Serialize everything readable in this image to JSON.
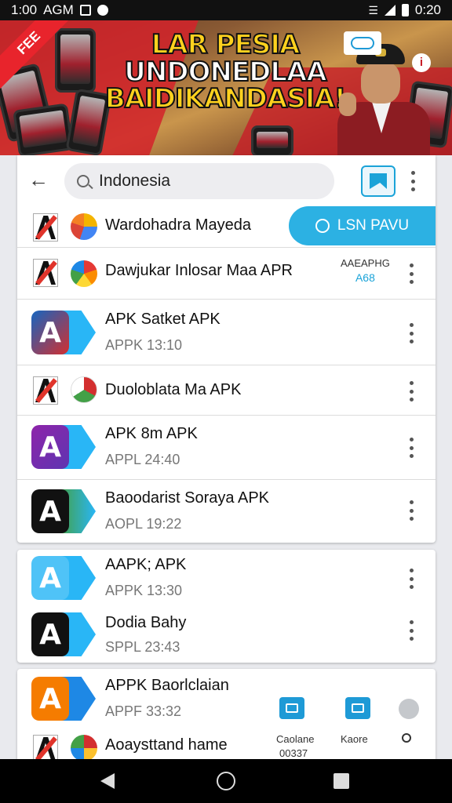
{
  "status_bar": {
    "time": "1:00",
    "carrier": "AGM",
    "right_text": "0:20"
  },
  "banner": {
    "ribbon": "FEE",
    "headline_line1": "LAR PESIA",
    "headline_line2": "UNDONEDLAA",
    "headline_line3": "BAIDIKANDASIA!"
  },
  "search": {
    "query": "Indonesia"
  },
  "install_button": {
    "label": "LSN PAVU"
  },
  "side_label": {
    "line1": "AAEAPHG",
    "line2": "A68"
  },
  "list1": [
    {
      "title": "Wardohadra Mayeda",
      "subtitle": ""
    },
    {
      "title": "Dawjukar Inlosar Maa APR",
      "subtitle": ""
    },
    {
      "title": "APK Satket APK",
      "subtitle": "APPK 13:10"
    },
    {
      "title": "Duoloblata Ma APK",
      "subtitle": ""
    },
    {
      "title": "APK 8m APK",
      "subtitle": "APPL 24:40"
    },
    {
      "title": "Baoodarist Soraya APK",
      "subtitle": "AOPL 19:22"
    }
  ],
  "list2": [
    {
      "title": "AAPK; APK",
      "subtitle": "APPK 13:30"
    },
    {
      "title": "Dodia Bahy",
      "subtitle": "SPPL 23:43"
    }
  ],
  "list3": [
    {
      "title": "APPK Baorlclaian",
      "subtitle": "APPF 33:32"
    },
    {
      "title": "Aoaysttand hame",
      "subtitle": ""
    }
  ],
  "card3_actions": {
    "label1": "Caolane",
    "sub1": "00337",
    "label2": "Kaore"
  },
  "colors": {
    "accent": "#2cb1e3",
    "banner_red": "#d3222a",
    "headline_yellow": "#ffd21e"
  }
}
